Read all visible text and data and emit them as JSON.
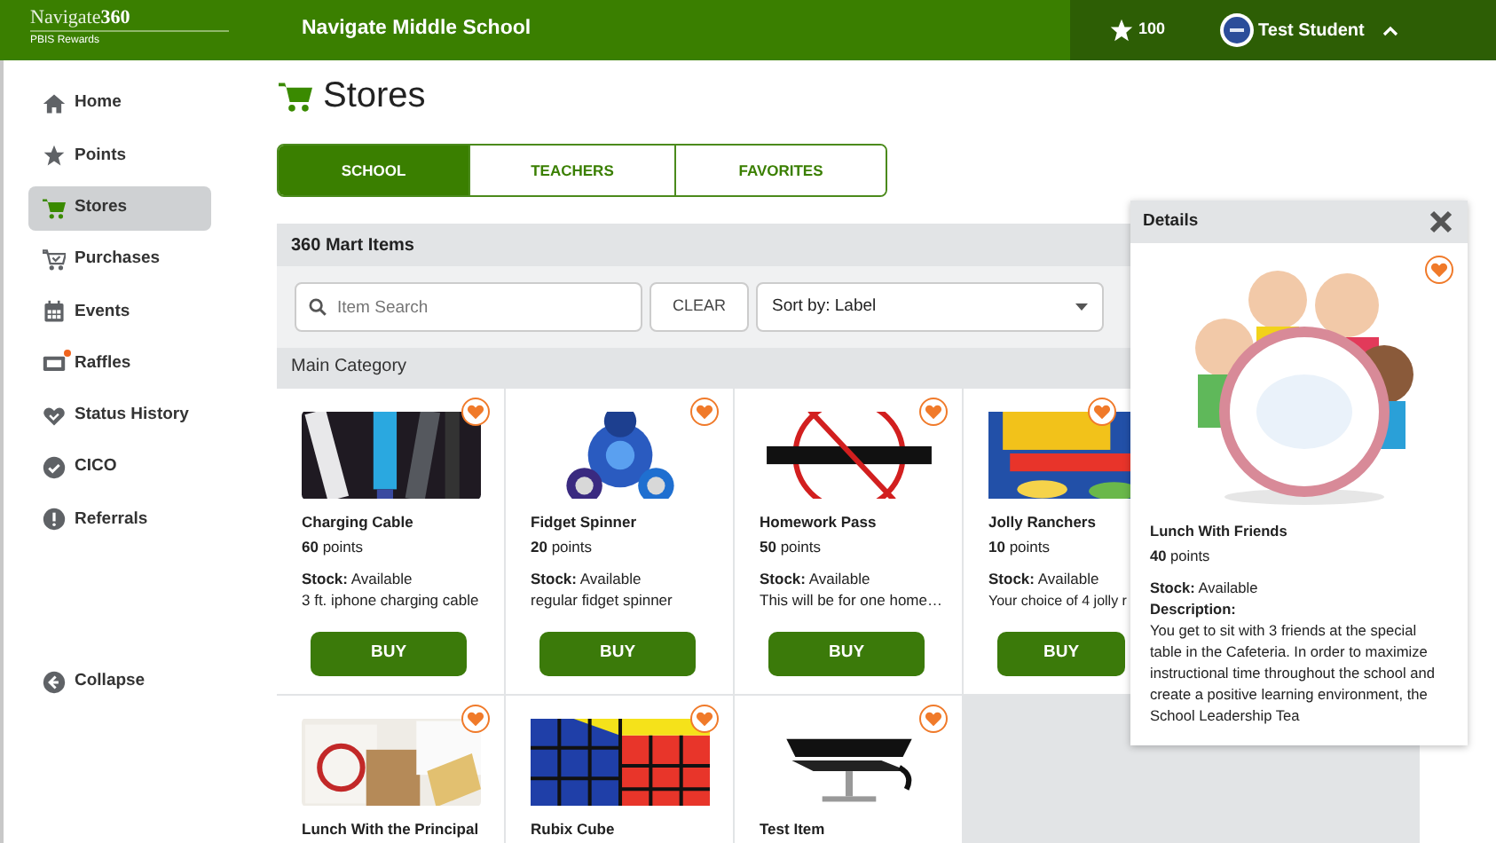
{
  "header": {
    "logo": "Navigate**360**",
    "logo_subtitle": "PBIS Rewards",
    "school": "Navigate Middle School",
    "points": "100",
    "user": "Test Student"
  },
  "sidebar": {
    "items": [
      {
        "label": "Home",
        "selected": false,
        "alert": false
      },
      {
        "label": "Points",
        "selected": false,
        "alert": false
      },
      {
        "label": "Stores",
        "selected": true,
        "alert": false
      },
      {
        "label": "Purchases",
        "selected": false,
        "alert": false
      },
      {
        "label": "Events",
        "selected": false,
        "alert": false
      },
      {
        "label": "Raffles",
        "selected": false,
        "alert": true
      },
      {
        "label": "Status History",
        "selected": false,
        "alert": false
      },
      {
        "label": "CICO",
        "selected": false,
        "alert": false
      },
      {
        "label": "Referrals",
        "selected": false,
        "alert": false
      }
    ],
    "collapse": "Collapse"
  },
  "page": {
    "title": "Stores"
  },
  "tabs": [
    {
      "label": "SCHOOL",
      "selected": true
    },
    {
      "label": "TEACHERS",
      "selected": false
    },
    {
      "label": "FAVORITES",
      "selected": false
    }
  ],
  "store": {
    "title": "360 Mart Items",
    "search": {
      "placeholder": "Item Search"
    },
    "clear": "CLEAR",
    "sort": "Sort by: Label",
    "category": "Main Category",
    "items": [
      {
        "name": "Charging Cable",
        "points": "**60** points",
        "stock": "**Stock:** Available",
        "description": "3 ft. iphone charging cable",
        "buy": "BUY"
      },
      {
        "name": "Fidget Spinner",
        "points": "**20** points",
        "stock": "**Stock:** Available",
        "description": "regular fidget spinner",
        "buy": "BUY"
      },
      {
        "name": "Homework Pass",
        "points": "**50** points",
        "stock": "**Stock:** Available",
        "description": "This will be for one home…",
        "buy": "BUY"
      },
      {
        "name": "Jolly Ranchers",
        "points": "**10** points",
        "stock": "**Stock:** Available",
        "description": "Your choice of 4 jolly r",
        "buy": "BUY"
      },
      {
        "name": "Lunch With the Principal"
      },
      {
        "name": "Rubix Cube"
      },
      {
        "name": "Test Item"
      }
    ]
  },
  "details": {
    "title": "Details",
    "name": "Lunch With Friends",
    "points": "**40** points",
    "stock": "**Stock:** Available",
    "description_label": "Description:",
    "description": "You get to sit with 3 friends at the special table in the Cafeteria. In order to maximize instructional time throughout the school and create a positive learning environment, the School Leadership Tea"
  }
}
